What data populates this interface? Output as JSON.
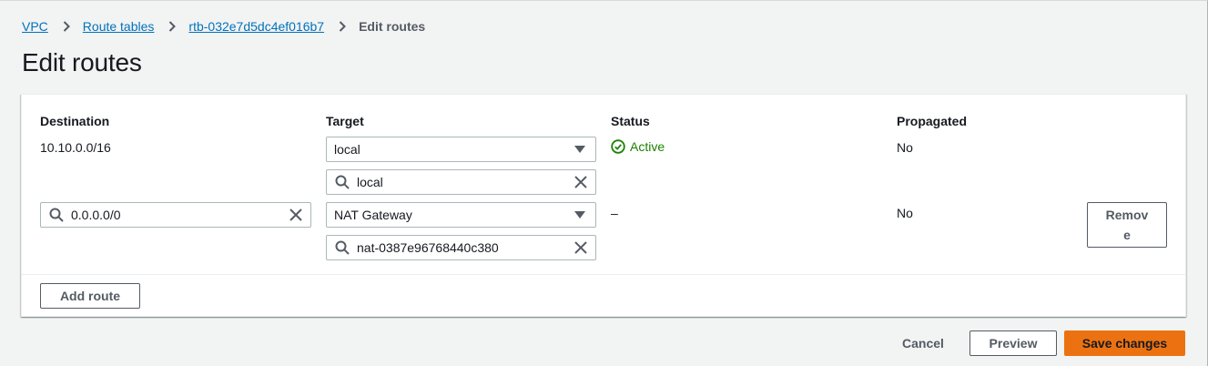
{
  "breadcrumb": {
    "items": [
      "VPC",
      "Route tables",
      "rtb-032e7d5dc4ef016b7"
    ],
    "current": "Edit routes"
  },
  "page": {
    "title": "Edit routes"
  },
  "table": {
    "headers": {
      "destination": "Destination",
      "target": "Target",
      "status": "Status",
      "propagated": "Propagated"
    },
    "rows": [
      {
        "destination": "10.10.0.0/16",
        "target_type": "local",
        "target_value": "local",
        "status": "Active",
        "propagated": "No"
      },
      {
        "destination": "0.0.0.0/0",
        "target_type": "NAT Gateway",
        "target_value": "nat-0387e96768440c380",
        "status": "–",
        "propagated": "No",
        "remove_label": "Remove"
      }
    ],
    "add_route_label": "Add route"
  },
  "footer": {
    "cancel_label": "Cancel",
    "preview_label": "Preview",
    "save_label": "Save changes"
  },
  "colors": {
    "link": "#0073bb",
    "primary": "#ec7211",
    "success": "#1d8102",
    "background": "#f2f3f3"
  },
  "icons": {
    "breadcrumb_separator": "chevron-right-icon",
    "search": "search-icon",
    "clear": "close-icon",
    "dropdown": "caret-down-icon",
    "status_active": "check-circle-icon"
  }
}
